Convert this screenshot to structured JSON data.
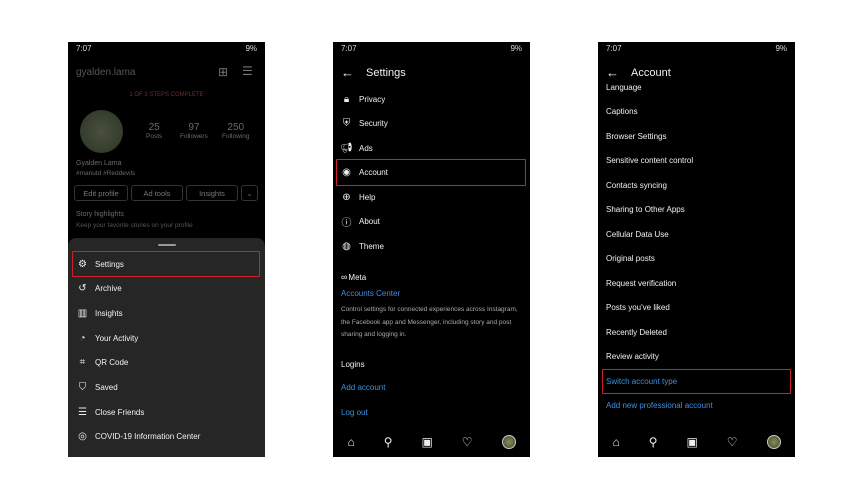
{
  "status": {
    "time": "7:07",
    "battery": "9%"
  },
  "profile": {
    "username": "gyalden.lama",
    "steps": "1 OF 3 STEPS COMPLETE",
    "posts": "25",
    "posts_label": "Posts",
    "followers": "97",
    "followers_label": "Followers",
    "following": "250",
    "following_label": "Following",
    "name": "Gyalden Lama",
    "bio": "#manutd #Reddevils",
    "buttons": [
      "Edit profile",
      "Ad tools",
      "Insights"
    ],
    "highlights_title": "Story highlights",
    "highlights_sub": "Keep your favorite stories on your profile"
  },
  "menu": [
    {
      "label": "Settings",
      "icon": "gear-icon"
    },
    {
      "label": "Archive",
      "icon": "archive-icon"
    },
    {
      "label": "Insights",
      "icon": "bar-chart-icon"
    },
    {
      "label": "Your Activity",
      "icon": "activity-icon"
    },
    {
      "label": "QR Code",
      "icon": "qr-code-icon"
    },
    {
      "label": "Saved",
      "icon": "bookmark-icon"
    },
    {
      "label": "Close Friends",
      "icon": "list-icon"
    },
    {
      "label": "COVID-19 Information Center",
      "icon": "covid-icon"
    }
  ],
  "settings": {
    "title": "Settings",
    "items": [
      {
        "label": "Privacy",
        "icon": "lock-icon"
      },
      {
        "label": "Security",
        "icon": "shield-icon"
      },
      {
        "label": "Ads",
        "icon": "megaphone-icon"
      },
      {
        "label": "Account",
        "icon": "user-circle-icon"
      },
      {
        "label": "Help",
        "icon": "help-icon"
      },
      {
        "label": "About",
        "icon": "info-icon"
      },
      {
        "label": "Theme",
        "icon": "palette-icon"
      }
    ],
    "meta": "Meta",
    "accounts_center": "Accounts Center",
    "description": "Control settings for connected experiences across Instagram, the Facebook app and Messenger, including story and post sharing and logging in.",
    "logins": "Logins",
    "add_account": "Add account",
    "log_out": "Log out"
  },
  "account": {
    "title": "Account",
    "items": [
      "Language",
      "Captions",
      "Browser Settings",
      "Sensitive content control",
      "Contacts syncing",
      "Sharing to Other Apps",
      "Cellular Data Use",
      "Original posts",
      "Request verification",
      "Posts you've liked",
      "Recently Deleted",
      "Review activity",
      "Switch account type",
      "Add new professional account"
    ]
  },
  "highlight_color": "#d0202a",
  "link_color": "#3d8fe0"
}
